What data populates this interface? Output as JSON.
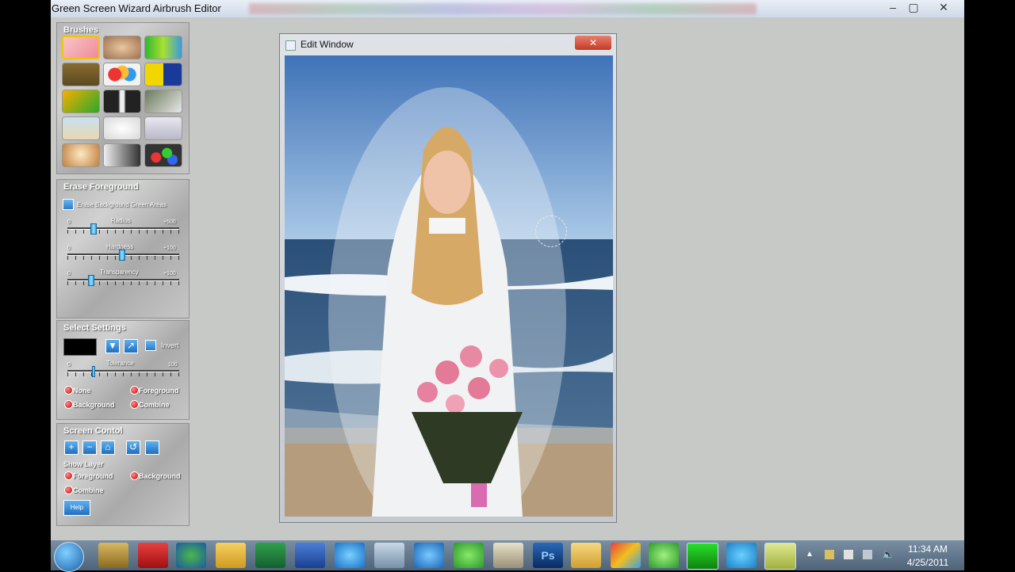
{
  "window": {
    "title": "Green Screen Wizard Airbrush Editor"
  },
  "brushes": {
    "title": "Brushes"
  },
  "erase": {
    "title": "Erase Foreground",
    "checkbox_label": "Erase Background Green Areas",
    "radius": {
      "label": "Radius",
      "min": "0",
      "max": "+500"
    },
    "hardness": {
      "label": "Hardness",
      "min": "0",
      "max": "+100"
    },
    "transparency": {
      "label": "Transparency",
      "min": "0",
      "max": "+100"
    }
  },
  "select": {
    "title": "Select Settings",
    "invert_label": "Invert",
    "tolerance": {
      "label": "Tolerance",
      "min": "0",
      "max": "100"
    },
    "radios": [
      "None",
      "Foreground",
      "Background",
      "Combine"
    ]
  },
  "screen": {
    "title": "Screen Contol",
    "show_layer": "Show Layer",
    "radios": [
      "Foreground",
      "Background",
      "Combine"
    ],
    "help_label": "Help"
  },
  "edit_window": {
    "title": "Edit Window"
  },
  "taskbar": {
    "time": "11:34 AM",
    "date": "4/25/2011"
  },
  "colors": {
    "accent": "#2a7cc8",
    "titlebar": "#e9eef6",
    "panel": "#c7c9c6"
  }
}
